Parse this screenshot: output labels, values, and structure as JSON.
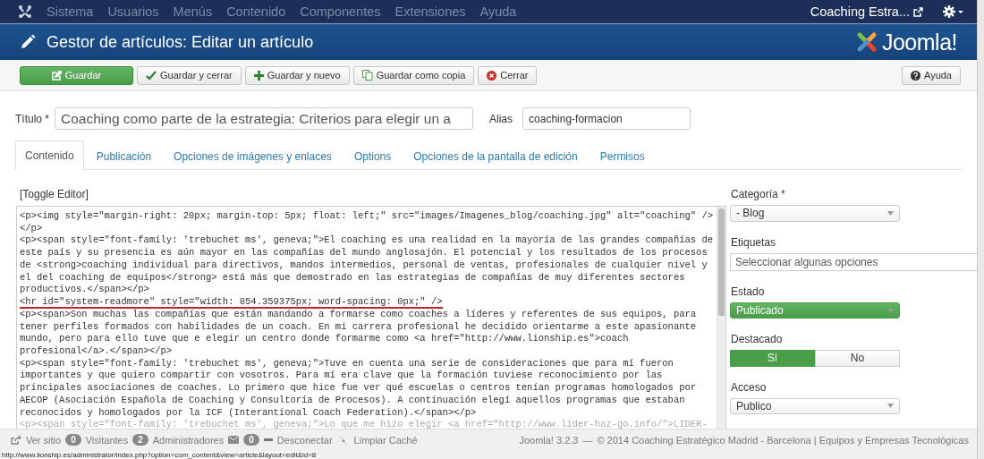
{
  "top_nav": {
    "items": [
      "Sistema",
      "Usuarios",
      "Menús",
      "Contenido",
      "Componentes",
      "Extensiones",
      "Ayuda"
    ],
    "site_link": "Coaching Estra..."
  },
  "header": {
    "title": "Gestor de artículos: Editar un artículo",
    "logo_text": "Joomla!"
  },
  "toolbar": {
    "buttons": [
      {
        "label": "Guardar",
        "primary": true
      },
      {
        "label": "Guardar y cerrar",
        "primary": false
      },
      {
        "label": "Guardar y nuevo",
        "primary": false
      },
      {
        "label": "Guardar como copia",
        "primary": false
      },
      {
        "label": "Cerrar",
        "primary": false
      }
    ],
    "help": "Ayuda"
  },
  "title_field": {
    "label": "Título *",
    "value": "Coaching como parte de la estrategia: Criterios para elegir un a"
  },
  "alias_field": {
    "label": "Alias",
    "value": "coaching-formacion"
  },
  "tabs": [
    {
      "label": "Contenido",
      "selected": true
    },
    {
      "label": "Publicación",
      "selected": false
    },
    {
      "label": "Opciones de imágenes y enlaces",
      "selected": false
    },
    {
      "label": "Options",
      "selected": false
    },
    {
      "label": "Opciones de la pantalla de edición",
      "selected": false
    },
    {
      "label": "Permisos",
      "selected": false
    }
  ],
  "editor": {
    "toggle": "[Toggle Editor]",
    "lines": [
      {
        "text": "<p><img style=\"margin-right: 20px; margin-top: 5px; float: left;\" src=\"images/Imagenes_blog/coaching.jpg\" alt=\"coaching\" />",
        "underlined": false,
        "dimmed": false
      },
      {
        "text": "</p>",
        "underlined": false,
        "dimmed": false
      },
      {
        "text": "<p><span style=\"font-family: 'trebuchet ms', geneva;\">El coaching es una realidad en la mayoría de las grandes compañías de",
        "underlined": false,
        "dimmed": false
      },
      {
        "text": "este país y su presencia es aún mayor en las compañías del mundo anglosajón. El potencial y los resultados de los procesos",
        "underlined": false,
        "dimmed": false
      },
      {
        "text": "de <strong>coaching individual para directivos, mandos intermedios, personal de ventas, profesionales de cualquier nivel y",
        "underlined": false,
        "dimmed": false
      },
      {
        "text": "el del coaching de equipos</strong> está más que demostrado en las estrategias de compañías de muy diferentes sectores",
        "underlined": false,
        "dimmed": false
      },
      {
        "text": "productivos.</span></p>",
        "underlined": false,
        "dimmed": false
      },
      {
        "text": "<hr id=\"system-readmore\" style=\"width: 854.359375px; word-spacing: 0px;\" />",
        "underlined": true,
        "dimmed": false
      },
      {
        "text": "<p><span>Son muchas las compañías que están mandando a formarse como coaches a líderes y referentes de sus equipos, para",
        "underlined": false,
        "dimmed": false
      },
      {
        "text": "tener perfiles formados con habilidades de un coach. En mi carrera profesional he decidido orientarme a este apasionante",
        "underlined": false,
        "dimmed": false
      },
      {
        "text": "mundo, pero para ello tuve que e elegir un centro donde formarme como <a href=\"http://www.lionship.es\">coach",
        "underlined": false,
        "dimmed": false
      },
      {
        "text": "profesional</a>.</span></p>",
        "underlined": false,
        "dimmed": false
      },
      {
        "text": "<p><span style=\"font-family: 'trebuchet ms', geneva;\">Tuve en cuenta una serie de consideraciones que para mí fueron",
        "underlined": false,
        "dimmed": false
      },
      {
        "text": "importantes y que quiero compartir con vosotros. Para mí era clave que la formación tuviese reconocimiento por las",
        "underlined": false,
        "dimmed": false
      },
      {
        "text": "principales asociaciones de coaches. Lo primero que hice fue ver qué escuelas o centros tenían programas homologados por",
        "underlined": false,
        "dimmed": false
      },
      {
        "text": "AECOP (Asociación Española de Coaching y Consultoría de Procesos). A continuación elegí aquellos programas que estaban",
        "underlined": false,
        "dimmed": false
      },
      {
        "text": "reconocidos y homologados por la ICF (Interantional Coach Federation).</span></p>",
        "underlined": false,
        "dimmed": false
      },
      {
        "text": "<p><span style=\"font-family: 'trebuchet ms', geneva;\">Lo que me hizo elegir <a href=\"http://www.lider-haz-go.info/\">LIDER-",
        "underlined": false,
        "dimmed": true
      }
    ]
  },
  "sidebar": {
    "category": {
      "label": "Categoría *",
      "value": "- Blog"
    },
    "tags": {
      "label": "Etiquetas",
      "placeholder": "Seleccionar algunas opciones"
    },
    "state": {
      "label": "Estado",
      "value": "Publicado"
    },
    "featured": {
      "label": "Destacado",
      "options": [
        {
          "label": "Sí",
          "selected": true
        },
        {
          "label": "No",
          "selected": false
        }
      ]
    },
    "access": {
      "label": "Acceso",
      "value": "Publico"
    }
  },
  "status_bar": {
    "view_site": "Ver sitio",
    "visitors_count": "0",
    "visitors": "Visitantes",
    "admins_count": "2",
    "admins": "Administradores",
    "messages_count": "0",
    "logout": "Desconectar",
    "clear_cache": "Limpiar Caché",
    "version": "Joomla! 3.2.3",
    "separator": "—",
    "copyright": "© 2014 Coaching Estratégico Madrid - Barcelona | Equipos y Empresas Tecnológicas"
  },
  "browser_status": "http://www.lionship.es/administrator/index.php?option=com_content&view=article&layout=edit&id=8"
}
